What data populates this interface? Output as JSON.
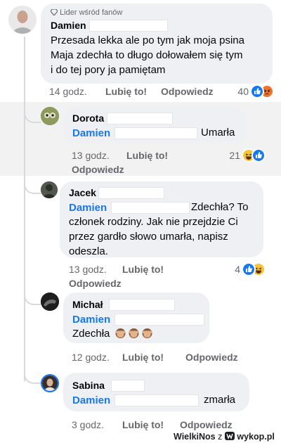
{
  "colors": {
    "link_blue": "#1877f2",
    "bubble_gray": "#eef0f3",
    "meta_gray": "#65676b",
    "like_blue": "#1877f2",
    "angry_orange": "#f0712b",
    "haha_yellow": "#f7c435"
  },
  "comments": [
    {
      "author": "Damien",
      "badge": "Lider wśród fanów",
      "badge_icon": "diamond-icon",
      "text_lines": [
        "Przesada lekka ale po tym jak moja psina",
        "Maja zdechła to długo dołowałem się tym",
        "i do tej pory ja pamiętam"
      ],
      "time": "14 godz.",
      "like_label": "Lubię to!",
      "reply_label": "Odpowiedz",
      "reaction_count": "40",
      "reactions": [
        "like",
        "angry"
      ]
    },
    {
      "author": "Dorota",
      "mention": "Damien",
      "text": "Umarła",
      "time": "13 godz.",
      "like_label": "Lubię to!",
      "reply_label": "Odpowiedz",
      "reaction_count": "21",
      "reactions": [
        "haha",
        "like"
      ]
    },
    {
      "author": "Jacek",
      "mention": "Damien",
      "text_first": "Zdechła? To",
      "text_lines": [
        "członek rodziny. Jak nie przejdzie Ci",
        "przez gardło słowo umarła, napisz",
        "odeszla."
      ],
      "time": "13 godz.",
      "like_label": "Lubię to!",
      "reply_label": "Odpowiedz",
      "reaction_count": "4",
      "reactions": [
        "like",
        "haha"
      ]
    },
    {
      "author": "Michał",
      "mention": "Damien",
      "text": "Zdechła",
      "emoji": [
        "see-no-evil-monkey-icon",
        "see-no-evil-monkey-icon",
        "see-no-evil-monkey-icon"
      ],
      "time": "12 godz.",
      "like_label": "Lubię to!",
      "reply_label": "Odpowiedz"
    },
    {
      "author": "Sabina",
      "mention": "Damien",
      "text": "zmarła",
      "time": "3 godz.",
      "like_label": "Lubię to!",
      "reply_label": "Odpowiedz"
    }
  ],
  "footer": {
    "user": "WielkiNos",
    "connector": "z",
    "site": "wykop.pl"
  }
}
